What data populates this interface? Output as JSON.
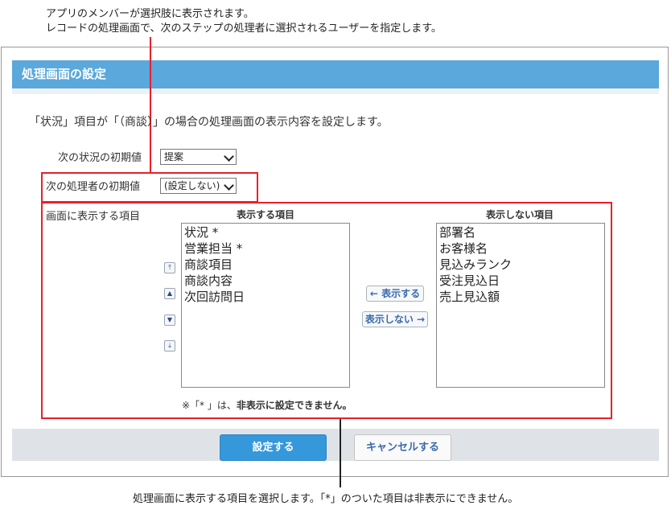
{
  "annotations": {
    "top_line1": "アプリのメンバーが選択肢に表示されます。",
    "top_line2": "レコードの処理画面で、次のステップの処理者に選択されるユーザーを指定します。",
    "bottom": "処理画面に表示する項目を選択します。「*」のついた項目は非表示にできません。"
  },
  "panel": {
    "title": "処理画面の設定",
    "description": "「状況」項目が「（商談）」の場合の処理画面の表示内容を設定します。"
  },
  "fields": {
    "next_status_label": "次の状況の初期値",
    "next_status_value": "提案",
    "next_assignee_label": "次の処理者の初期値",
    "next_assignee_value": "(設定しない)",
    "display_items_label": "画面に表示する項目"
  },
  "lists": {
    "shown_header": "表示する項目",
    "shown_items": [
      "状況 *",
      "営業担当 *",
      "商談項目",
      "商談内容",
      "次回訪問日"
    ],
    "hidden_header": "表示しない項目",
    "hidden_items": [
      "部署名",
      "お客様名",
      "見込みランク",
      "受注見込日",
      "売上見込額"
    ]
  },
  "buttons": {
    "show": "← 表示する",
    "hide": "表示しない →",
    "save": "設定する",
    "cancel": "キャンセルする",
    "move_top": "⤒",
    "move_up": "▲",
    "move_down": "▼",
    "move_bottom": "⤓"
  },
  "note": {
    "prefix": "※「* 」は、",
    "bold": "非表示に設定できません。"
  },
  "colors": {
    "header_bg": "#5aa8dc",
    "highlight": "#e8202a",
    "primary_button": "#3498db"
  }
}
